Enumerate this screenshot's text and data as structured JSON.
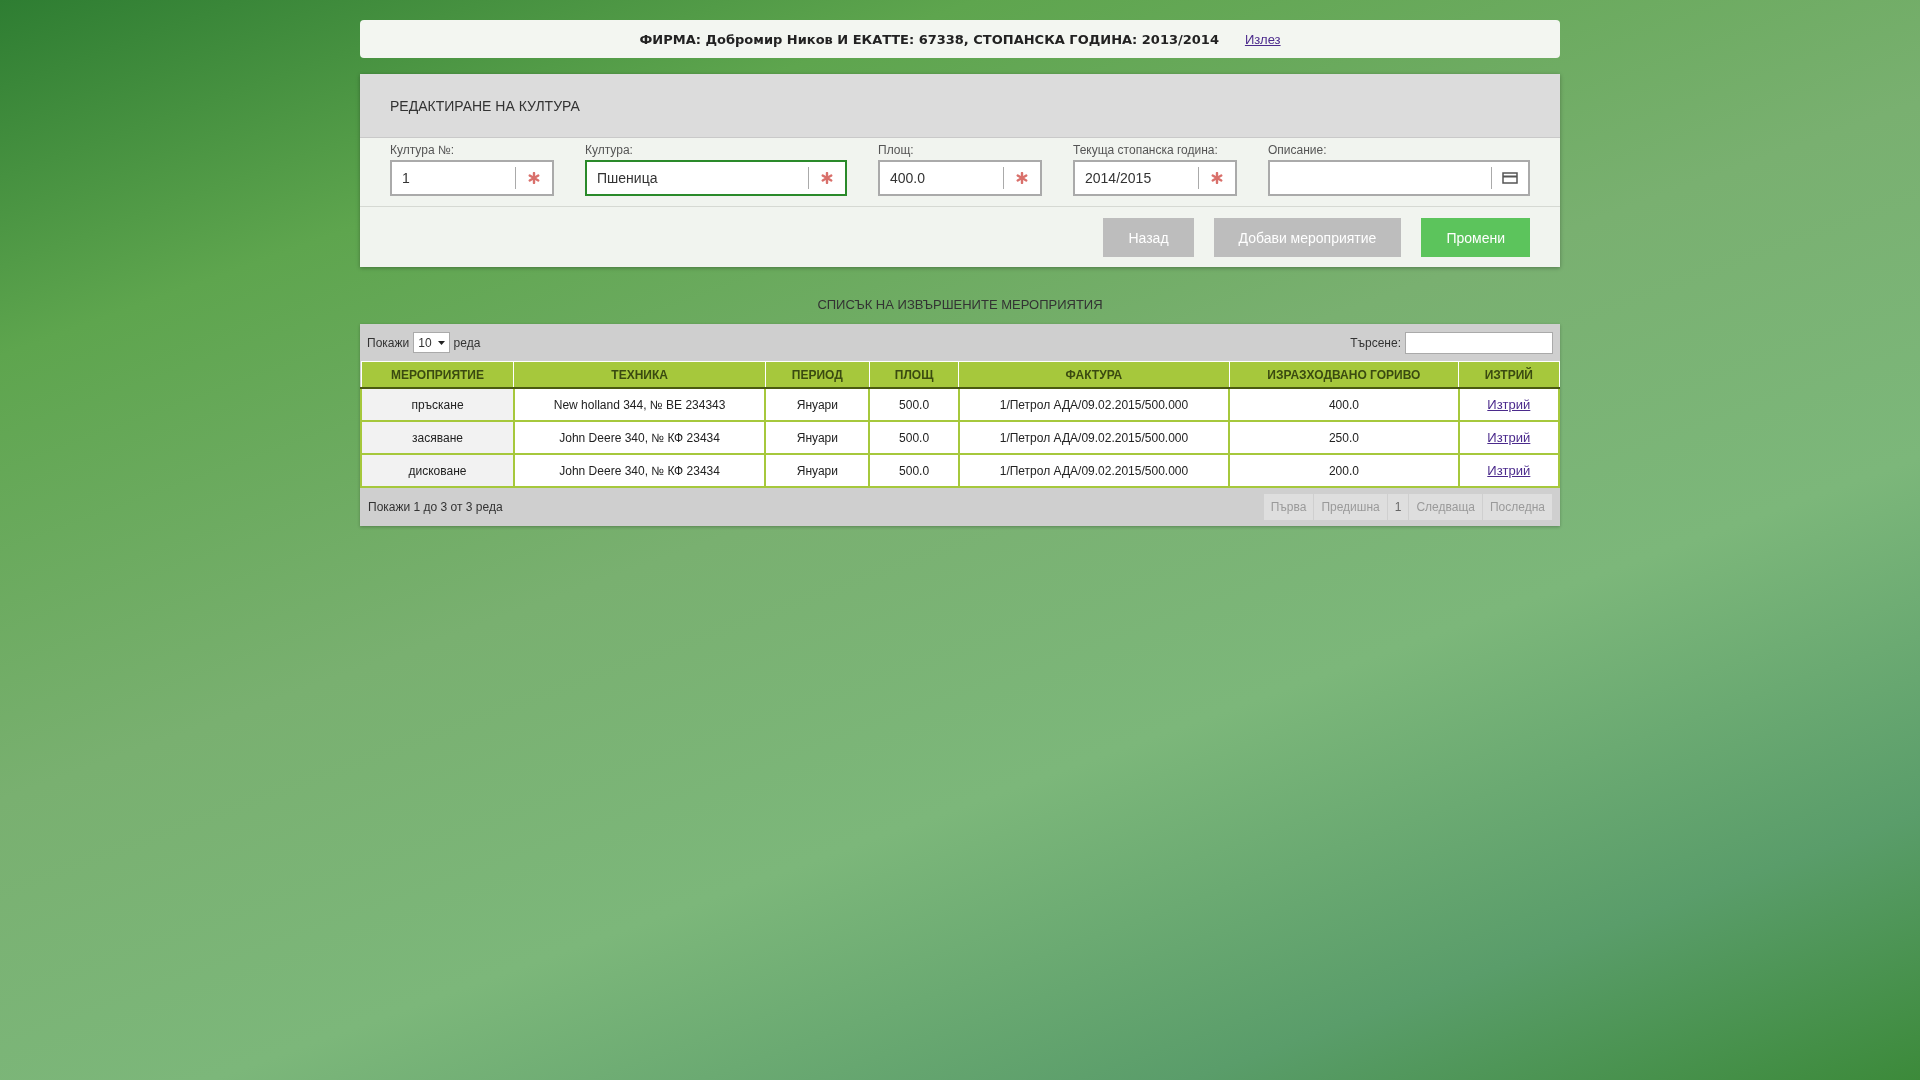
{
  "header": {
    "title": "ФИРМА: Добромир Ников И ЕКАТТЕ: 67338, СТОПАНСКА ГОДИНА: 2013/2014",
    "logout": "Излез"
  },
  "form": {
    "title": "РЕДАКТИРАНЕ НА КУЛТУРА",
    "fields": [
      {
        "label": "Култура №:",
        "value": "1",
        "kind": "required",
        "focused": false
      },
      {
        "label": "Култура:",
        "value": "Пшеница",
        "kind": "required",
        "focused": true
      },
      {
        "label": "Площ:",
        "value": "400.0",
        "kind": "required",
        "focused": false
      },
      {
        "label": "Текуща стопанска година:",
        "value": "2014/2015",
        "kind": "required",
        "focused": false
      },
      {
        "label": "Описание:",
        "kind": "text",
        "focused": false
      }
    ],
    "buttons": [
      {
        "label": "Назад",
        "kind": "secondary"
      },
      {
        "label": "Добави мероприятие",
        "kind": "secondary"
      },
      {
        "label": "Промени",
        "kind": "primary"
      }
    ]
  },
  "list": {
    "title": "СПИСЪК НА ИЗВЪРШЕНИТЕ МЕРОПРИЯТИЯ",
    "show_label": "Покажи",
    "page_size": "10",
    "rows_label": "реда",
    "search_label": "Търсене:",
    "columns": [
      "МЕРОПРИЯТИЕ",
      "ТЕХНИКА",
      "ПЕРИОД",
      "ПЛОЩ",
      "ФАКТУРА",
      "ИЗРАЗХОДВАНО ГОРИВО",
      "ИЗТРИЙ"
    ],
    "rows": [
      [
        "пръскане",
        "New holland 344, № ВЕ 234343",
        "Януари",
        "500.0",
        "1/Петрол АДА/09.02.2015/500.000",
        "400.0",
        "Изтрий"
      ],
      [
        "засяване",
        "John Deere 340, № КФ 23434",
        "Януари",
        "500.0",
        "1/Петрол АДА/09.02.2015/500.000",
        "250.0",
        "Изтрий"
      ],
      [
        "дисковане",
        "John Deere 340, № КФ 23434",
        "Януари",
        "500.0",
        "1/Петрол АДА/09.02.2015/500.000",
        "200.0",
        "Изтрий"
      ]
    ],
    "info": "Покажи 1 до 3 от 3 реда",
    "pages": [
      {
        "label": "Първа",
        "disabled": true
      },
      {
        "label": "Предишна",
        "disabled": true
      },
      {
        "label": "1",
        "disabled": false
      },
      {
        "label": "Следваща",
        "disabled": true
      },
      {
        "label": "Последна",
        "disabled": true
      }
    ]
  }
}
